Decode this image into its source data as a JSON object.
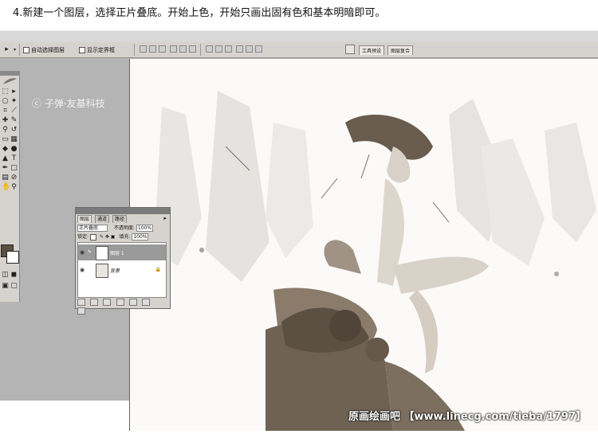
{
  "caption": "4.新建一个图层，选择正片叠底。开始上色，开始只画出固有色和基本明暗即可。",
  "options_bar": {
    "auto_select": "自动选择图层",
    "show_bounds": "显示定界框",
    "tab_tool_presets": "工具预设",
    "tab_layer_comps": "图层复合"
  },
  "watermark": "ⓒ 子弹·友基科技",
  "footer_watermark": "原画绘画吧 【www.linecg.com/tieba/1797】",
  "layers_panel": {
    "tabs": [
      "图层",
      "通道",
      "路径"
    ],
    "blend_mode": "正片叠底",
    "opacity_label": "不透明度:",
    "opacity_value": "100%",
    "lock_label": "锁定:",
    "fill_label": "填充:",
    "fill_value": "100%",
    "layers": [
      {
        "name": "图层 1",
        "selected": true
      },
      {
        "name": "背景",
        "selected": false
      }
    ]
  },
  "colors": {
    "foreground": "#5b5142",
    "background": "#ffffff",
    "workspace": "#b4b4b4",
    "sketch": "#5a4d40"
  }
}
